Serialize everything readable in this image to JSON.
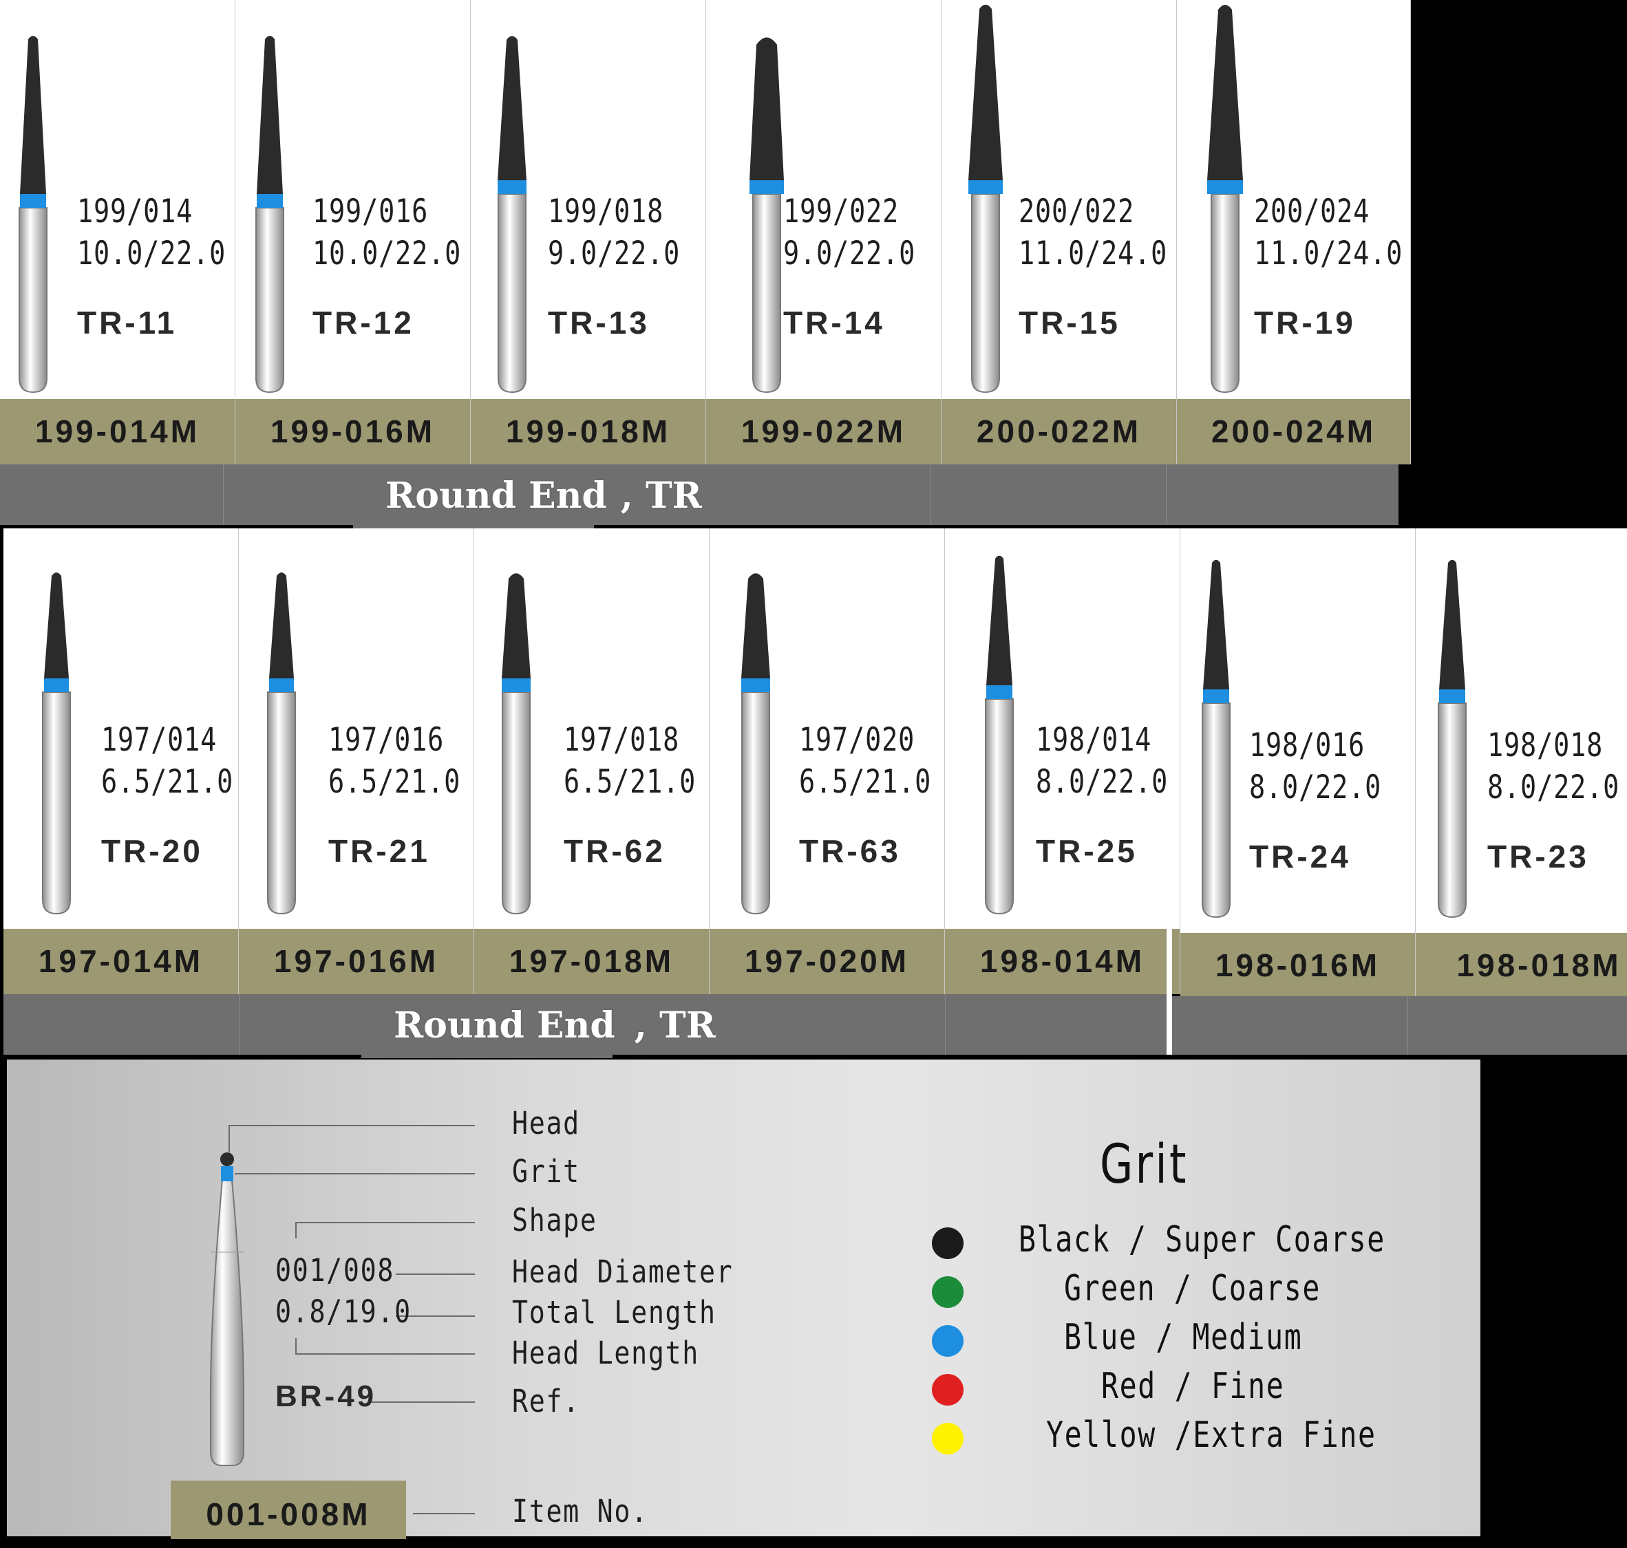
{
  "section1": {
    "title": "Round End",
    "title_suffix": ", TR",
    "items": [
      {
        "size": "199/014",
        "length": "10.0/22.0",
        "ref": "TR-11",
        "item_no": "199-014M"
      },
      {
        "size": "199/016",
        "length": "10.0/22.0",
        "ref": "TR-12",
        "item_no": "199-016M"
      },
      {
        "size": "199/018",
        "length": "9.0/22.0",
        "ref": "TR-13",
        "item_no": "199-018M"
      },
      {
        "size": "199/022",
        "length": "9.0/22.0",
        "ref": "TR-14",
        "item_no": "199-022M"
      },
      {
        "size": "200/022",
        "length": "11.0/24.0",
        "ref": "TR-15",
        "item_no": "200-022M"
      },
      {
        "size": "200/024",
        "length": "11.0/24.0",
        "ref": "TR-19",
        "item_no": "200-024M"
      }
    ]
  },
  "section2": {
    "title": "Round End",
    "title_suffix": ", TR",
    "items": [
      {
        "size": "197/014",
        "length": "6.5/21.0",
        "ref": "TR-20",
        "item_no": "197-014M"
      },
      {
        "size": "197/016",
        "length": "6.5/21.0",
        "ref": "TR-21",
        "item_no": "197-016M"
      },
      {
        "size": "197/018",
        "length": "6.5/21.0",
        "ref": "TR-62",
        "item_no": "197-018M"
      },
      {
        "size": "197/020",
        "length": "6.5/21.0",
        "ref": "TR-63",
        "item_no": "197-020M"
      },
      {
        "size": "198/014",
        "length": "8.0/22.0",
        "ref": "TR-25",
        "item_no": "198-014M"
      },
      {
        "size": "198/016",
        "length": "8.0/22.0",
        "ref": "TR-24",
        "item_no": "198-016M"
      },
      {
        "size": "198/018",
        "length": "8.0/22.0",
        "ref": "TR-23",
        "item_no": "198-018M"
      }
    ]
  },
  "legend": {
    "sample": {
      "size": "001/008",
      "length": "0.8/19.0",
      "ref": "BR-49",
      "item_no": "001-008M"
    },
    "labels": {
      "head": "Head",
      "grit": "Grit",
      "shape": "Shape",
      "head_diameter": "Head Diameter",
      "total_length": "Total Length",
      "head_length": "Head Length",
      "ref": "Ref.",
      "item_no": "Item No."
    },
    "grit_title": "Grit",
    "grits": [
      {
        "label": "Black  /  Super Coarse",
        "color": "#1a1a1a"
      },
      {
        "label": "Green  / Coarse",
        "color": "#1a8c3a"
      },
      {
        "label": "Blue  /  Medium",
        "color": "#1e8fe0"
      },
      {
        "label": "Red  / Fine",
        "color": "#e02020"
      },
      {
        "label": "Yellow /Extra Fine",
        "color": "#fff200"
      }
    ]
  },
  "colors": {
    "grit_band": "#1e8fe0",
    "head": "#2b2b2b",
    "item_bar": "#9b9872",
    "title_band": "#6f6f6f"
  }
}
